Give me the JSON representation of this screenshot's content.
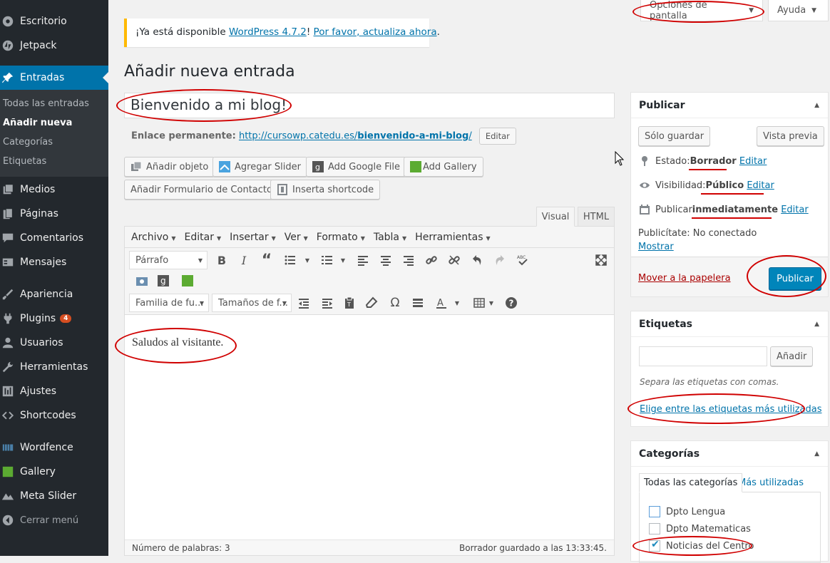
{
  "sidebar": {
    "items": [
      {
        "label": "Escritorio",
        "icon": "dashboard-icon"
      },
      {
        "label": "Jetpack",
        "icon": "jetpack-icon"
      },
      {
        "label": "Entradas",
        "icon": "pin-icon"
      },
      {
        "label": "Medios",
        "icon": "media-icon"
      },
      {
        "label": "Páginas",
        "icon": "pages-icon"
      },
      {
        "label": "Comentarios",
        "icon": "comment-icon"
      },
      {
        "label": "Mensajes",
        "icon": "messages-icon"
      },
      {
        "label": "Apariencia",
        "icon": "brush-icon"
      },
      {
        "label": "Plugins",
        "icon": "plugin-icon",
        "badge": "4"
      },
      {
        "label": "Usuarios",
        "icon": "users-icon"
      },
      {
        "label": "Herramientas",
        "icon": "wrench-icon"
      },
      {
        "label": "Ajustes",
        "icon": "settings-icon"
      },
      {
        "label": "Shortcodes",
        "icon": "code-icon"
      },
      {
        "label": "Wordfence",
        "icon": "wordfence-icon"
      },
      {
        "label": "Gallery",
        "icon": "gallery-icon"
      },
      {
        "label": "Meta Slider",
        "icon": "slider-icon"
      },
      {
        "label": "Cerrar menú",
        "icon": "collapse-icon"
      }
    ],
    "submenu": [
      "Todas las entradas",
      "Añadir nueva",
      "Categorías",
      "Etiquetas"
    ]
  },
  "top": {
    "screen_options": "Opciones de pantalla",
    "help": "Ayuda"
  },
  "notice": {
    "prefix": "¡Ya está disponible ",
    "version_link": "WordPress 4.7.2",
    "sep": "! ",
    "update_link": "Por favor, actualiza ahora",
    "suffix": "."
  },
  "page_title": "Añadir nueva entrada",
  "post": {
    "title": "Bienvenido a mi blog!",
    "permalink_label": "Enlace permanente:",
    "permalink_base": "http://cursowp.catedu.es/",
    "permalink_slug": "bienvenido-a-mi-blog",
    "permalink_end": "/",
    "permalink_edit": "Editar",
    "content": "Saludos al visitante."
  },
  "media_buttons": [
    "Añadir objeto",
    "Agregar Slider",
    "Add Google File",
    "Add Gallery",
    "Añadir Formulario de Contacto",
    "Inserta shortcode"
  ],
  "editor": {
    "tabs": [
      "Visual",
      "HTML"
    ],
    "menu": [
      "Archivo",
      "Editar",
      "Insertar",
      "Ver",
      "Formato",
      "Tabla",
      "Herramientas"
    ],
    "format_select": "Párrafo",
    "font_family": "Familia de fu...",
    "font_size": "Tamaños de f...",
    "word_count_label": "Número de palabras: 3",
    "saved_status": "Borrador guardado a las 13:33:45."
  },
  "publish": {
    "title": "Publicar",
    "save_draft": "Sólo guardar",
    "preview": "Vista previa",
    "status_label": "Estado: ",
    "status_value": "Borrador",
    "visibility_label": "Visibilidad: ",
    "visibility_value": "Público",
    "publish_label": "Publicar ",
    "publish_value": "inmediatamente",
    "edit": "Editar",
    "publicize": "Publicítate: No conectado",
    "show": "Mostrar",
    "trash": "Mover a la papelera",
    "publish_button": "Publicar"
  },
  "tags": {
    "title": "Etiquetas",
    "add": "Añadir",
    "hint": "Separa las etiquetas con comas.",
    "choose": "Elige entre las etiquetas más utilizadas"
  },
  "categories": {
    "title": "Categorías",
    "tab_all": "Todas las categorías",
    "tab_used": "Más utilizadas",
    "items": [
      {
        "label": "Dpto Lengua",
        "checked": false
      },
      {
        "label": "Dpto Matematicas",
        "checked": false
      },
      {
        "label": "Noticias del Centro",
        "checked": true
      }
    ]
  },
  "colors": {
    "accent": "#0073aa",
    "primary": "#0085ba",
    "annotation": "#d00000",
    "sidebar": "#23282d"
  }
}
